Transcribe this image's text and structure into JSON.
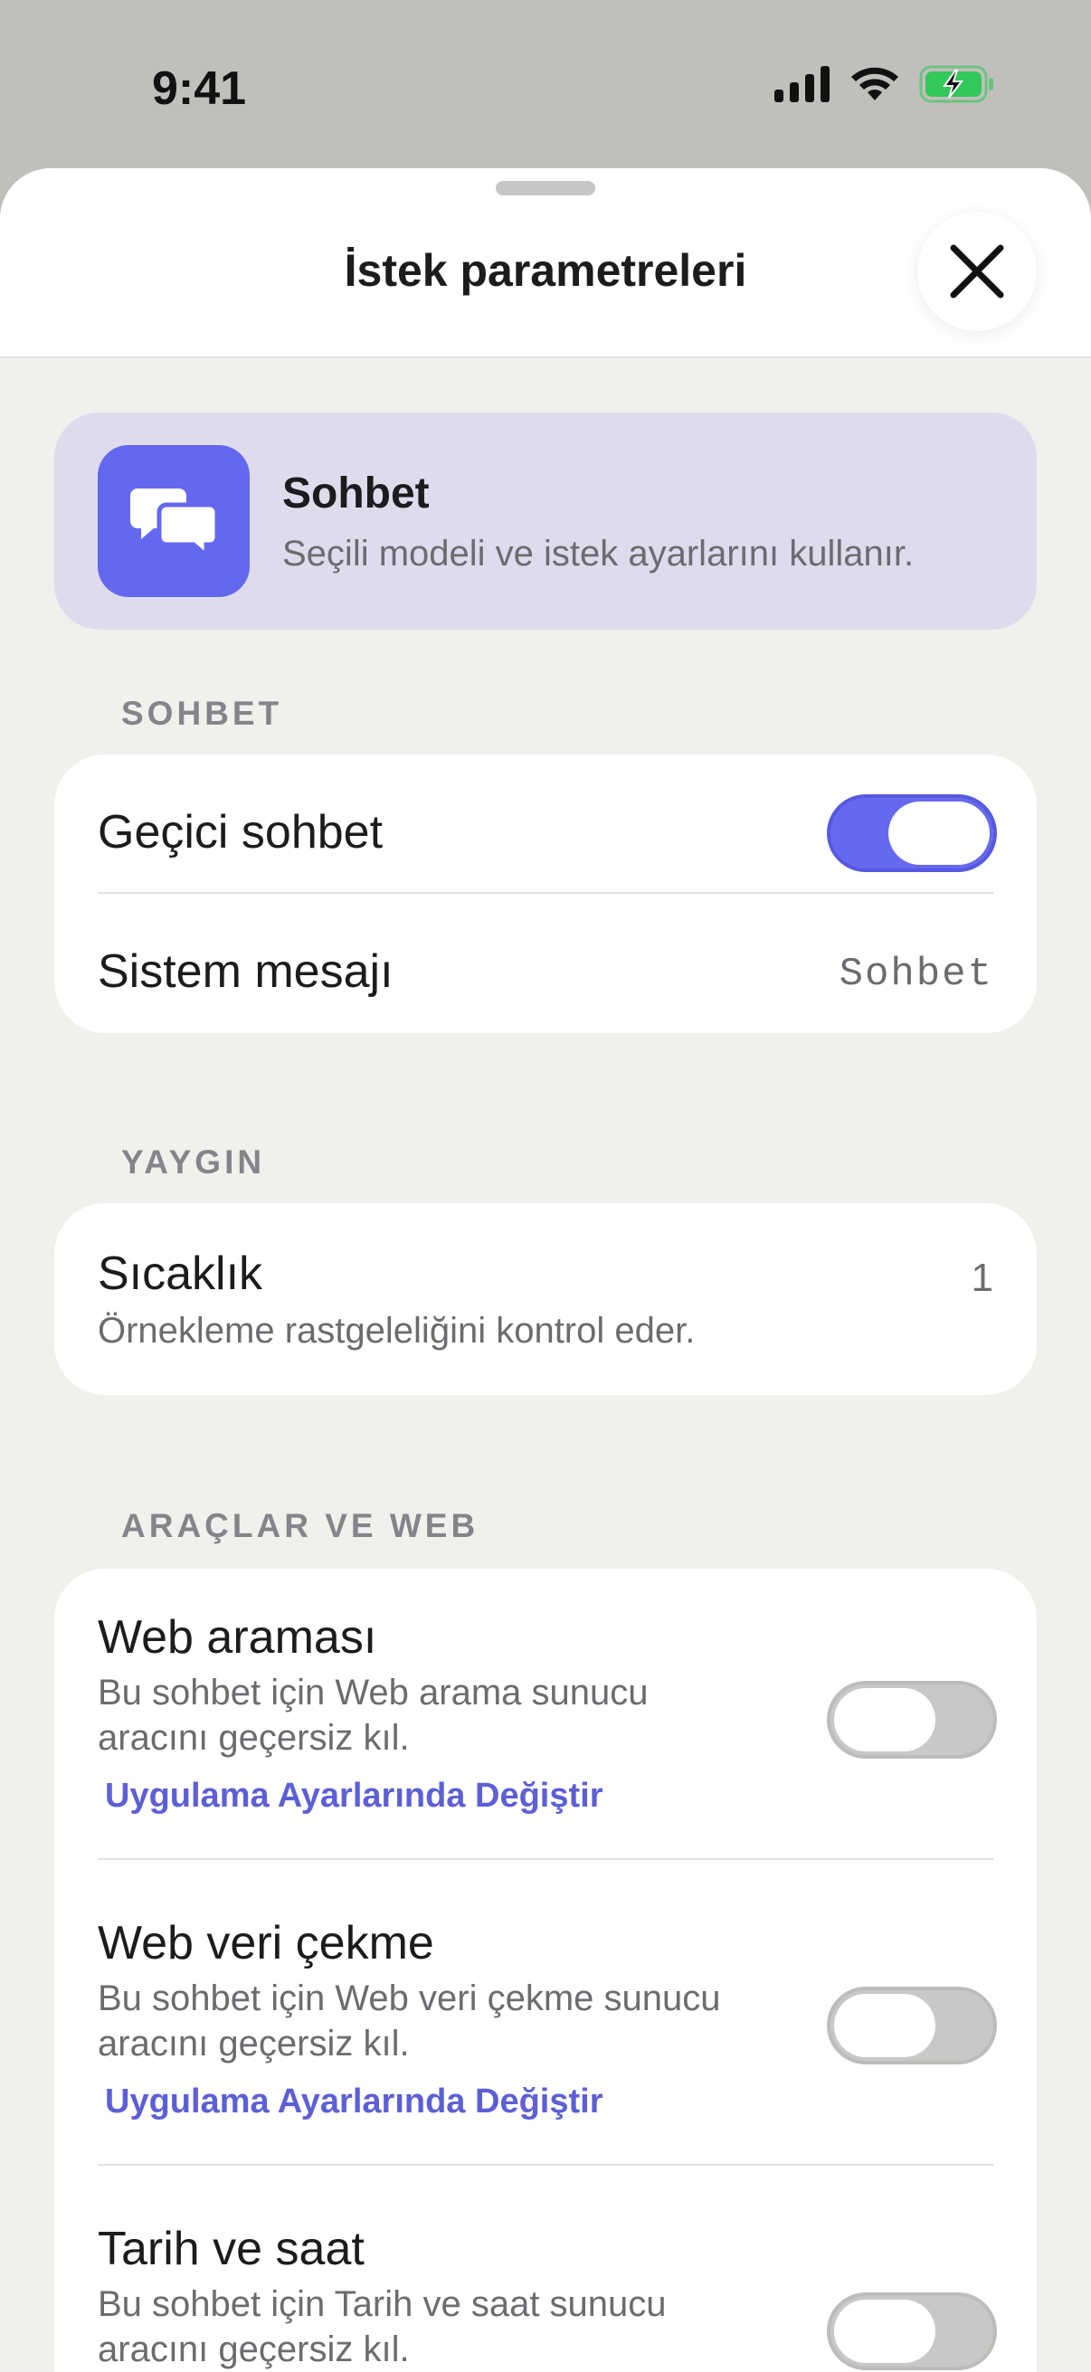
{
  "status_bar": {
    "time": "9:41",
    "icons": [
      "cellular-signal-icon",
      "wifi-icon",
      "battery-charging-icon"
    ]
  },
  "header": {
    "title": "İstek parametreleri",
    "close_icon": "close-icon"
  },
  "mode_card": {
    "title": "Sohbet",
    "description": "Seçili modeli ve istek ayarlarını kullanır.",
    "icon": "chat-bubbles-icon",
    "accent_color": "#6468ee"
  },
  "sections": {
    "chat": {
      "label": "SOHBET",
      "temporary_chat": {
        "title": "Geçici sohbet",
        "enabled": true
      },
      "system_message": {
        "title": "Sistem mesajı",
        "value": "Sohbet"
      }
    },
    "common": {
      "label": "YAYGIN",
      "temperature": {
        "title": "Sıcaklık",
        "description": "Örnekleme rastgeleliğini kontrol eder.",
        "value": "1"
      }
    },
    "tools": {
      "label": "ARAÇLAR VE WEB",
      "web_search": {
        "title": "Web araması",
        "description_line1": "Bu sohbet için Web arama sunucu",
        "description_line2": "aracını geçersiz kıl.",
        "link": "Uygulama Ayarlarında Değiştir",
        "enabled": false
      },
      "web_fetch": {
        "title": "Web veri çekme",
        "description_line1": "Bu sohbet için Web veri çekme sunucu",
        "description_line2": "aracını geçersiz kıl.",
        "link": "Uygulama Ayarlarında Değiştir",
        "enabled": false
      },
      "date_time": {
        "title": "Tarih ve saat",
        "description_line1": "Bu sohbet için Tarih ve saat sunucu",
        "description_line2": "aracını geçersiz kıl.",
        "enabled": false
      }
    }
  },
  "colors": {
    "toggle_on": "#6669ee",
    "toggle_off": "#c9c8c6",
    "link": "#5c5fd6",
    "battery": "#34c759"
  }
}
